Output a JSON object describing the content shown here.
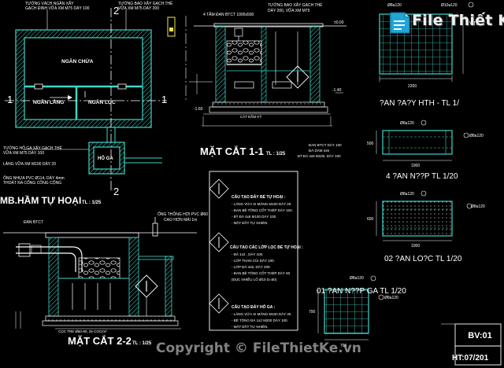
{
  "watermark": {
    "logo_text": "File Thiết Kế",
    "logo_suffix": ".vn",
    "copyright": "Copyright © FileThietKe.vn"
  },
  "plan": {
    "title": "MB.HẦM TỰ HOẠI",
    "scale": "TL : 1/25",
    "room_chua": "NGĂN CHỨA",
    "room_lang": "NGĂN LẮNG",
    "room_loc": "NGĂN LỌC",
    "room_hoga": "HỐ GA",
    "note_top_left_1": "TƯỜNG VÁCH NGĂN XÂY",
    "note_top_left_2": "GẠCH ĐINH VỮA XM M75 DÀY 100",
    "note_top_right_1": "TƯỜNG BAO XÂY GẠCH THẺ",
    "note_top_right_2": "VỮA XM M75 DÀY 200",
    "note_bottom_1": "TƯỜNG HỐ GA XÂY GẠCH THẺ",
    "note_bottom_2": "VỮA XM M75 DÀY 100",
    "note_bottom_3": "LÁNG VỮA XM M100 DÀY 20",
    "note_bottom_4": "ỐNG NHỰA PVC Ø114, DÀY 4mm",
    "note_bottom_5": "THOÁT RA CỐNG CÔNG CỘNG",
    "mark_1": "1",
    "mark_2": "2"
  },
  "section11": {
    "title": "MẶT CẮT 1-1",
    "scale": "TL : 1/25",
    "note_1": "4 TẤM ĐAN BTCT 1000x500",
    "note_2": "TƯỜNG BAO XÂY GẠCH THẺ",
    "note_3": "DÀY 200, VỮA XM M75",
    "note_4": "ĐAN BTCT DÀY 100",
    "note_5": "ĐÁ DĂM 4x6",
    "note_6": "BT ĐÁ 4x6 M100, DÀY 100",
    "note_7": "CÁT ĐẦM KỸ",
    "level_1": "±0.00",
    "level_2": "-1.40",
    "level_3": "-1.60"
  },
  "section22": {
    "title": "MẶT CẮT 2-2",
    "scale": "TL : 1/25",
    "note_1": "ĐAN BTCT",
    "note_2": "ỐNG THÔNG HƠI PVC Ø60",
    "note_3": "CAO HƠN MÁI 1m",
    "note_4": "CỌC TRE Ø60-80, 25 CỌC/m²"
  },
  "legend": {
    "heading_1": "CẤU TẠO ĐÁY BỂ TỰ HOẠI :",
    "items_1": [
      "- LÁNG VỮA XI MĂNG M100 DÀY 20.",
      "- ĐAN BÊ TÔNG CỐT THÉP DÀY 100.",
      "- BT ĐÁ 4x6 M100 DÀY 100.",
      "- MẶT ĐẤT TỰ NHIÊN."
    ],
    "heading_2": "CẤU TẠO CÁC LỚP LỌC BỂ TỰ HOẠI :",
    "items_2": [
      "- ĐÁ 1x2 , DÀY 100.",
      "- LỚP THAN CỦI DÀY 100.",
      "- LỚP ĐÁ 4x6, DÀY 200.",
      "- ĐAN BÊ TÔNG CỐT THÉP DÀY 60",
      "  (ĐỤC NHIỀU LỖ Ø10 D=50)"
    ],
    "heading_3": "CẤU TẠO ĐÁY HỐ GA :",
    "items_3": [
      "- LÁNG VỮA XI MĂNG M100 DÀY 30.",
      "- BÊ TÔNG ĐÁ 1x2 M200 DÀY 100.",
      "- MẶT ĐẤT TỰ NHIÊN."
    ]
  },
  "details": {
    "detail1_title": "?AN  ?A?Y HTH  - TL 1/",
    "detail2_title": "4  ?AN  N??P  TL 1/20",
    "detail3_title": "02  ?AN    LO?C  TL 1/20",
    "detail4_title": "01  ?AN  N??P  GA  TL 1/20",
    "dim_2200": "2200",
    "dim_1000": "1000",
    "dim_1000b": "1000",
    "dim_500": "500",
    "dim_600": "600",
    "dim_700": "700",
    "dim_700b": "700",
    "rebar_1": "Ø8a120",
    "rebar_2": "Ø10a120",
    "rebar_3": "Ø8a120",
    "rebar_4": "Ø8a120",
    "rebar_5": "Ø8a120",
    "rebar_6": "Ø8a120",
    "rebar_7": "Ø8a120",
    "rebar_8": "Ø8a120"
  },
  "titleblock": {
    "sheet": "BV:01",
    "code": "HT:07/201"
  },
  "colors": {
    "wall": "#3fd6c8",
    "line": "#ffffff",
    "dim": "#00e0ff",
    "text": "#ffffff",
    "accent": "#ff3030",
    "yellow": "#f2e84a"
  }
}
